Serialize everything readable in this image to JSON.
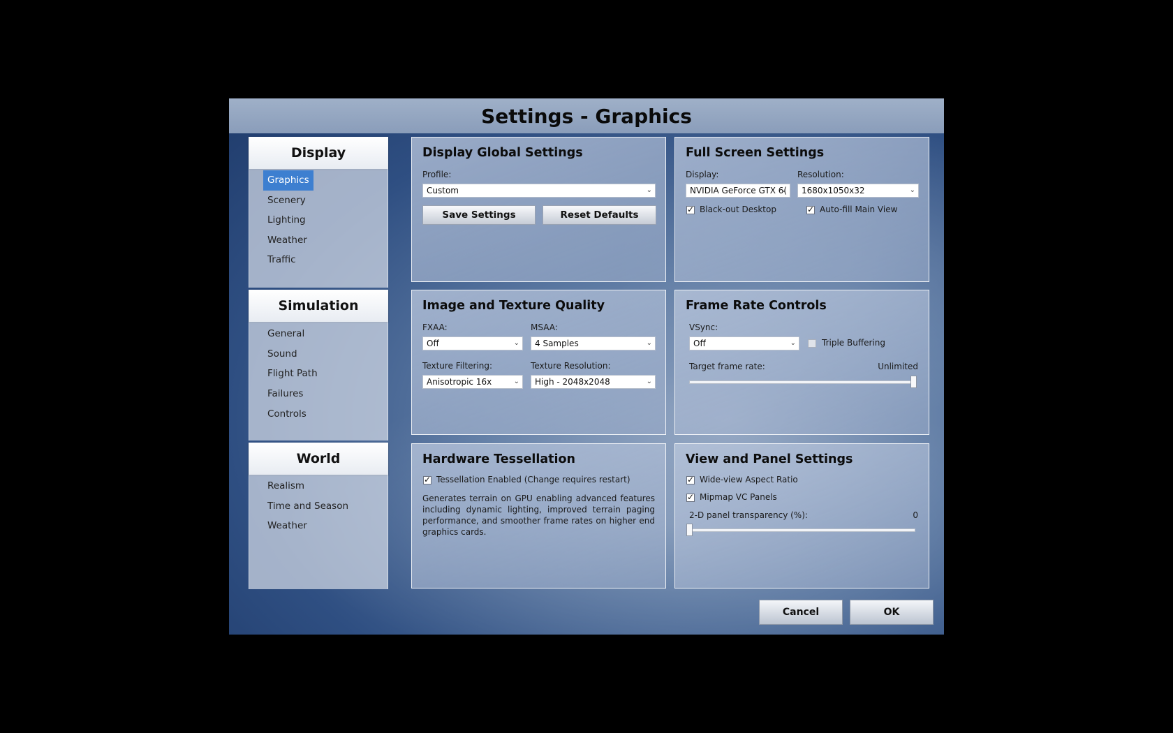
{
  "window": {
    "title": "Settings - Graphics"
  },
  "sidebar": {
    "groups": [
      {
        "title": "Display",
        "items": [
          "Graphics",
          "Scenery",
          "Lighting",
          "Weather",
          "Traffic"
        ],
        "active": "Graphics"
      },
      {
        "title": "Simulation",
        "items": [
          "General",
          "Sound",
          "Flight Path",
          "Failures",
          "Controls"
        ]
      },
      {
        "title": "World",
        "items": [
          "Realism",
          "Time and Season",
          "Weather"
        ]
      }
    ]
  },
  "display_global": {
    "title": "Display Global Settings",
    "profile_label": "Profile:",
    "profile_value": "Custom",
    "save_label": "Save Settings",
    "reset_label": "Reset Defaults"
  },
  "full_screen": {
    "title": "Full Screen Settings",
    "display_label": "Display:",
    "display_value": "NVIDIA GeForce GTX 6(",
    "resolution_label": "Resolution:",
    "resolution_value": "1680x1050x32",
    "blackout_label": "Black-out Desktop",
    "blackout_checked": true,
    "autofill_label": "Auto-fill Main View",
    "autofill_checked": true
  },
  "image_texture": {
    "title": "Image and Texture Quality",
    "fxaa_label": "FXAA:",
    "fxaa_value": "Off",
    "msaa_label": "MSAA:",
    "msaa_value": "4 Samples",
    "filtering_label": "Texture Filtering:",
    "filtering_value": "Anisotropic 16x",
    "resolution_label": "Texture Resolution:",
    "resolution_value": "High - 2048x2048"
  },
  "frame_rate": {
    "title": "Frame Rate Controls",
    "vsync_label": "VSync:",
    "vsync_value": "Off",
    "triple_label": "Triple Buffering",
    "triple_checked": false,
    "target_label": "Target frame rate:",
    "target_value": "Unlimited",
    "target_slider_fraction": 1.0
  },
  "tessellation": {
    "title": "Hardware Tessellation",
    "enabled_label": "Tessellation Enabled (Change requires restart)",
    "enabled_checked": true,
    "description": "Generates terrain on GPU enabling advanced features including dynamic lighting, improved terrain paging performance, and smoother frame rates on higher end graphics cards."
  },
  "view_panel": {
    "title": "View and Panel Settings",
    "wideview_label": "Wide-view Aspect Ratio",
    "wideview_checked": true,
    "mipmap_label": "Mipmap VC Panels",
    "mipmap_checked": true,
    "transparency_label": "2-D panel transparency (%):",
    "transparency_value": "0",
    "transparency_slider_fraction": 0.0
  },
  "footer": {
    "cancel_label": "Cancel",
    "ok_label": "OK"
  }
}
